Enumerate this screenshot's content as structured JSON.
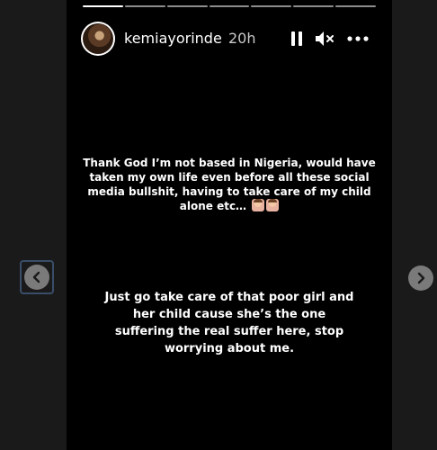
{
  "story": {
    "username": "kemiayorinde",
    "time": "20h",
    "segments": 7,
    "active_segment": 0
  },
  "icons": {
    "pause": "pause-icon",
    "mute": "speaker-muted-icon",
    "more": "more-horizontal-icon",
    "prev": "chevron-left-icon",
    "next": "chevron-right-icon"
  },
  "text": {
    "message1_line1": "Thank God I’m not based in Nigeria, would have",
    "message1_line2": "taken my own life even before all these social",
    "message1_line3": "media bullshit, having to take care of my child",
    "message1_line4": "alone etc…",
    "message2_line1": "Just go take care of that poor girl and",
    "message2_line2": "her child cause she’s the one",
    "message2_line3": "suffering the real suffer here, stop",
    "message2_line4": "worrying about me."
  },
  "colors": {
    "background": "#1a1a1a",
    "story_bg": "#000000",
    "text": "#ffffff"
  }
}
